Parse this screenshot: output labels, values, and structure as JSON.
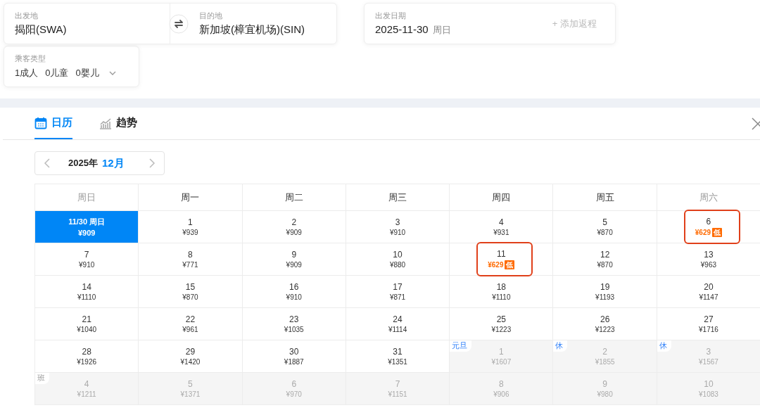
{
  "route": {
    "origin_label": "出发地",
    "origin": "揭阳(SWA)",
    "destination_label": "目的地",
    "destination": "新加坡(樟宜机场)(SIN)"
  },
  "date": {
    "label": "出发日期",
    "value": "2025-11-30",
    "weekday": "周日",
    "add_return": "+ 添加返程"
  },
  "passengers": {
    "label": "乘客类型",
    "items": [
      "1成人",
      "0儿童",
      "0婴儿"
    ]
  },
  "tabs": [
    {
      "label": "日历",
      "selected": true,
      "kind": "calendar"
    },
    {
      "label": "趋势",
      "selected": false,
      "kind": "trend"
    }
  ],
  "month_nav": {
    "year": "2025年",
    "month": "12月"
  },
  "weekdays": [
    {
      "label": "周日",
      "weekend": true
    },
    {
      "label": "周一",
      "weekend": false
    },
    {
      "label": "周二",
      "weekend": false
    },
    {
      "label": "周三",
      "weekend": false
    },
    {
      "label": "周四",
      "weekend": false
    },
    {
      "label": "周五",
      "weekend": false
    },
    {
      "label": "周六",
      "weekend": true
    }
  ],
  "cells": [
    {
      "day": "11/30 周日",
      "price": "¥909",
      "selected": true,
      "other_month": false,
      "highlighted": false
    },
    {
      "day": "1",
      "price": "¥939",
      "selected": false,
      "other_month": false,
      "highlighted": false
    },
    {
      "day": "2",
      "price": "¥909",
      "selected": false,
      "other_month": false,
      "highlighted": false
    },
    {
      "day": "3",
      "price": "¥910",
      "selected": false,
      "other_month": false,
      "highlighted": false
    },
    {
      "day": "4",
      "price": "¥931",
      "selected": false,
      "other_month": false,
      "highlighted": false
    },
    {
      "day": "5",
      "price": "¥870",
      "selected": false,
      "other_month": false,
      "highlighted": false
    },
    {
      "day": "6",
      "price": "¥629",
      "low_badge": "低",
      "selected": false,
      "other_month": false,
      "highlighted": true
    },
    {
      "day": "7",
      "price": "¥910",
      "selected": false,
      "other_month": false,
      "highlighted": false
    },
    {
      "day": "8",
      "price": "¥771",
      "selected": false,
      "other_month": false,
      "highlighted": false
    },
    {
      "day": "9",
      "price": "¥909",
      "selected": false,
      "other_month": false,
      "highlighted": false
    },
    {
      "day": "10",
      "price": "¥880",
      "selected": false,
      "other_month": false,
      "highlighted": false
    },
    {
      "day": "11",
      "price": "¥629",
      "low_badge": "低",
      "selected": false,
      "other_month": false,
      "highlighted": true
    },
    {
      "day": "12",
      "price": "¥870",
      "selected": false,
      "other_month": false,
      "highlighted": false
    },
    {
      "day": "13",
      "price": "¥963",
      "selected": false,
      "other_month": false,
      "highlighted": false
    },
    {
      "day": "14",
      "price": "¥1110",
      "selected": false,
      "other_month": false,
      "highlighted": false
    },
    {
      "day": "15",
      "price": "¥870",
      "selected": false,
      "other_month": false,
      "highlighted": false
    },
    {
      "day": "16",
      "price": "¥910",
      "selected": false,
      "other_month": false,
      "highlighted": false
    },
    {
      "day": "17",
      "price": "¥871",
      "selected": false,
      "other_month": false,
      "highlighted": false
    },
    {
      "day": "18",
      "price": "¥1110",
      "selected": false,
      "other_month": false,
      "highlighted": false
    },
    {
      "day": "19",
      "price": "¥1193",
      "selected": false,
      "other_month": false,
      "highlighted": false
    },
    {
      "day": "20",
      "price": "¥1147",
      "selected": false,
      "other_month": false,
      "highlighted": false
    },
    {
      "day": "21",
      "price": "¥1040",
      "selected": false,
      "other_month": false,
      "highlighted": false
    },
    {
      "day": "22",
      "price": "¥961",
      "selected": false,
      "other_month": false,
      "highlighted": false
    },
    {
      "day": "23",
      "price": "¥1035",
      "selected": false,
      "other_month": false,
      "highlighted": false
    },
    {
      "day": "24",
      "price": "¥1114",
      "selected": false,
      "other_month": false,
      "highlighted": false
    },
    {
      "day": "25",
      "price": "¥1223",
      "selected": false,
      "other_month": false,
      "highlighted": false
    },
    {
      "day": "26",
      "price": "¥1223",
      "selected": false,
      "other_month": false,
      "highlighted": false
    },
    {
      "day": "27",
      "price": "¥1716",
      "selected": false,
      "other_month": false,
      "highlighted": false
    },
    {
      "day": "28",
      "price": "¥1926",
      "selected": false,
      "other_month": false,
      "highlighted": false
    },
    {
      "day": "29",
      "price": "¥1420",
      "selected": false,
      "other_month": false,
      "highlighted": false
    },
    {
      "day": "30",
      "price": "¥1887",
      "selected": false,
      "other_month": false,
      "highlighted": false
    },
    {
      "day": "31",
      "price": "¥1351",
      "selected": false,
      "other_month": false,
      "highlighted": false
    },
    {
      "day": "1",
      "price": "¥1607",
      "tag": "元旦",
      "kind": "holiday",
      "selected": false,
      "other_month": true,
      "highlighted": false
    },
    {
      "day": "2",
      "price": "¥1855",
      "tag": "休",
      "kind": "holiday",
      "selected": false,
      "other_month": true,
      "highlighted": false
    },
    {
      "day": "3",
      "price": "¥1567",
      "tag": "休",
      "kind": "holiday",
      "selected": false,
      "other_month": true,
      "highlighted": false
    },
    {
      "day": "4",
      "price": "¥1211",
      "tag": "班",
      "kind": "workday",
      "selected": false,
      "other_month": true,
      "highlighted": false
    },
    {
      "day": "5",
      "price": "¥1371",
      "selected": false,
      "other_month": true,
      "highlighted": false
    },
    {
      "day": "6",
      "price": "¥970",
      "selected": false,
      "other_month": true,
      "highlighted": false
    },
    {
      "day": "7",
      "price": "¥1151",
      "selected": false,
      "other_month": true,
      "highlighted": false
    },
    {
      "day": "8",
      "price": "¥906",
      "selected": false,
      "other_month": true,
      "highlighted": false
    },
    {
      "day": "9",
      "price": "¥980",
      "selected": false,
      "other_month": true,
      "highlighted": false
    },
    {
      "day": "10",
      "price": "¥1083",
      "selected": false,
      "other_month": true,
      "highlighted": false
    }
  ]
}
